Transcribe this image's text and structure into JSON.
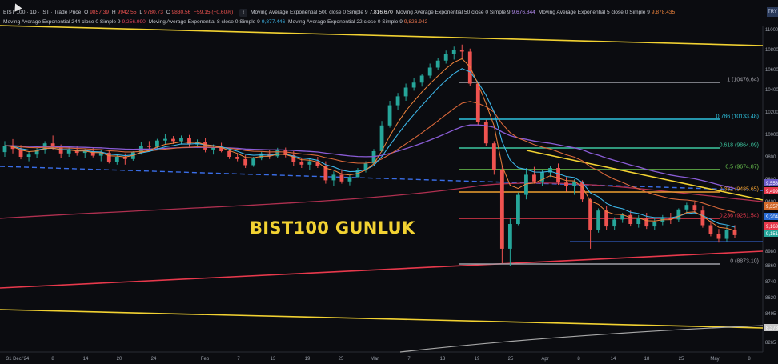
{
  "symbol_info": {
    "symbol": "BIST 100 · 1D · IST · Trade Price",
    "open_label": "O",
    "open": "9857.39",
    "high_label": "H",
    "high": "9942.55",
    "low_label": "L",
    "low": "9780.73",
    "close_label": "C",
    "close": "9830.56",
    "change": "−59.15 (−0.60%)"
  },
  "indicators_row1": [
    {
      "label": "Moving Average Exponential 500 close 0 Simple 9",
      "value": "7,816.670",
      "color": "#ffffff"
    },
    {
      "label": "Moving Average Exponential 50 close 0 Simple 9",
      "value": "9,676.844",
      "color": "#b48cf0"
    },
    {
      "label": "Moving Average Exponential 5 close 0 Simple 9",
      "value": "9,878.435",
      "color": "#f0843c"
    }
  ],
  "indicators_row2": [
    {
      "label": "Moving Average Exponential 244 close 0 Simple 9",
      "value": "9,256.990",
      "color": "#e0445c"
    },
    {
      "label": "Moving Average Exponential 8 close 0 Simple 9",
      "value": "9,877.446",
      "color": "#3cb4e6"
    },
    {
      "label": "Moving Average Exponential 22 close 0 Simple 9",
      "value": "9,826.942",
      "color": "#f07850"
    }
  ],
  "chart_label": "BIST100 GUNLUK",
  "currency_button": "TRY",
  "colors": {
    "background": "#0b0c10",
    "up": "#26a69a",
    "down": "#ef5350",
    "trendline": "#f2d232",
    "accent_red": "#e8394c"
  },
  "chart_data": {
    "type": "candlestick",
    "x_ticks": [
      "31 Dec '24",
      "8",
      "14",
      "20",
      "24",
      "Feb",
      "7",
      "13",
      "19",
      "25",
      "Mar",
      "7",
      "13",
      "19",
      "25",
      "Apr",
      "8",
      "14",
      "18",
      "25",
      "May",
      "8"
    ],
    "y_ticks": [
      11000,
      10800,
      10600,
      10400,
      10200,
      10000,
      9800,
      9600,
      9400,
      9200,
      8980,
      8860,
      8740,
      8620,
      8495,
      8378,
      8265
    ],
    "fibonacci": [
      {
        "level": "1 (10476.64)",
        "color": "#a0a0a8"
      },
      {
        "level": "0.786 (10133.48)",
        "color": "#2ec4e0"
      },
      {
        "level": "0.618 (9864.09)",
        "color": "#3cc8a0"
      },
      {
        "level": "0.5 (9674.87)",
        "color": "#6cc850"
      },
      {
        "level": "0.382 (9485.65)",
        "color": "#f0a030"
      },
      {
        "level": "0.236 (9251.54)",
        "color": "#e8394c"
      },
      {
        "level": "0 (8873.10)",
        "color": "#a0a0a8"
      }
    ],
    "price_tags": [
      {
        "value": "9,558",
        "color": "#6c5cc8"
      },
      {
        "value": "9,499",
        "color": "#e8394c"
      },
      {
        "value": "9,357",
        "color": "#d46a2a"
      },
      {
        "value": "9,204",
        "color": "#2a6cd4"
      },
      {
        "value": "9,163",
        "color": "#e8394c"
      },
      {
        "value": "9,151",
        "color": "#26a69a"
      },
      {
        "value": "8,378",
        "color": "#c8c8c8"
      }
    ],
    "candles": [
      [
        9842,
        9940,
        9800,
        9900
      ],
      [
        9900,
        9958,
        9830,
        9870
      ],
      [
        9870,
        9905,
        9778,
        9800
      ],
      [
        9800,
        9850,
        9760,
        9820
      ],
      [
        9820,
        9880,
        9790,
        9860
      ],
      [
        9860,
        9940,
        9830,
        9920
      ],
      [
        9920,
        9990,
        9860,
        9885
      ],
      [
        9885,
        9910,
        9790,
        9830
      ],
      [
        9830,
        9888,
        9800,
        9860
      ],
      [
        9860,
        9900,
        9810,
        9835
      ],
      [
        9835,
        9870,
        9790,
        9850
      ],
      [
        9850,
        9880,
        9795,
        9810
      ],
      [
        9810,
        9860,
        9760,
        9835
      ],
      [
        9835,
        9860,
        9740,
        9755
      ],
      [
        9755,
        9820,
        9730,
        9800
      ],
      [
        9800,
        9830,
        9730,
        9780
      ],
      [
        9780,
        9850,
        9765,
        9840
      ],
      [
        9840,
        9930,
        9820,
        9900
      ],
      [
        9900,
        9940,
        9860,
        9888
      ],
      [
        9888,
        9960,
        9870,
        9945
      ],
      [
        9945,
        10000,
        9910,
        9960
      ],
      [
        9960,
        9985,
        9915,
        9940
      ],
      [
        9940,
        9990,
        9910,
        9965
      ],
      [
        9965,
        9995,
        9890,
        9910
      ],
      [
        9910,
        9955,
        9880,
        9935
      ],
      [
        9935,
        9965,
        9840,
        9865
      ],
      [
        9865,
        9910,
        9820,
        9880
      ],
      [
        9880,
        9925,
        9840,
        9850
      ],
      [
        9850,
        9875,
        9780,
        9800
      ],
      [
        9800,
        9830,
        9760,
        9780
      ],
      [
        9780,
        9815,
        9700,
        9725
      ],
      [
        9725,
        9800,
        9710,
        9785
      ],
      [
        9785,
        9850,
        9770,
        9830
      ],
      [
        9830,
        9860,
        9780,
        9805
      ],
      [
        9805,
        9880,
        9790,
        9860
      ],
      [
        9860,
        9882,
        9795,
        9815
      ],
      [
        9815,
        9850,
        9720,
        9750
      ],
      [
        9750,
        9790,
        9700,
        9730
      ],
      [
        9730,
        9780,
        9680,
        9760
      ],
      [
        9760,
        9800,
        9700,
        9720
      ],
      [
        9720,
        9760,
        9560,
        9590
      ],
      [
        9590,
        9670,
        9540,
        9640
      ],
      [
        9640,
        9690,
        9560,
        9580
      ],
      [
        9580,
        9640,
        9545,
        9620
      ],
      [
        9620,
        9700,
        9610,
        9680
      ],
      [
        9680,
        9760,
        9660,
        9740
      ],
      [
        9740,
        9870,
        9730,
        9850
      ],
      [
        9850,
        10120,
        9840,
        10080
      ],
      [
        10080,
        10300,
        10060,
        10260
      ],
      [
        10260,
        10370,
        10220,
        10340
      ],
      [
        10340,
        10460,
        10300,
        10420
      ],
      [
        10420,
        10520,
        10390,
        10470
      ],
      [
        10470,
        10560,
        10430,
        10540
      ],
      [
        10540,
        10660,
        10510,
        10620
      ],
      [
        10620,
        10720,
        10600,
        10690
      ],
      [
        10690,
        10790,
        10660,
        10760
      ],
      [
        10760,
        10830,
        10700,
        10800
      ],
      [
        10800,
        10850,
        10720,
        10780
      ],
      [
        10780,
        10810,
        10440,
        10460
      ],
      [
        10460,
        10480,
        10080,
        10110
      ],
      [
        10110,
        10130,
        9900,
        9920
      ],
      [
        9920,
        9940,
        9640,
        9680
      ],
      [
        9680,
        9720,
        8880,
        9000
      ],
      [
        9000,
        9250,
        8860,
        9200
      ],
      [
        9200,
        9480,
        9190,
        9460
      ],
      [
        9460,
        9700,
        9420,
        9640
      ],
      [
        9640,
        9710,
        9560,
        9580
      ],
      [
        9580,
        9680,
        9540,
        9660
      ],
      [
        9660,
        9720,
        9620,
        9700
      ],
      [
        9700,
        9740,
        9550,
        9570
      ],
      [
        9570,
        9620,
        9490,
        9540
      ],
      [
        9540,
        9600,
        9460,
        9580
      ],
      [
        9580,
        9590,
        9400,
        9420
      ],
      [
        9420,
        9430,
        9000,
        9150
      ],
      [
        9150,
        9340,
        9130,
        9320
      ],
      [
        9320,
        9360,
        9150,
        9180
      ],
      [
        9180,
        9260,
        9150,
        9240
      ],
      [
        9240,
        9300,
        9210,
        9280
      ],
      [
        9280,
        9320,
        9180,
        9200
      ],
      [
        9200,
        9280,
        9170,
        9250
      ],
      [
        9250,
        9300,
        9160,
        9180
      ],
      [
        9180,
        9250,
        9150,
        9220
      ],
      [
        9220,
        9280,
        9190,
        9260
      ],
      [
        9260,
        9300,
        9200,
        9240
      ],
      [
        9240,
        9340,
        9220,
        9330
      ],
      [
        9330,
        9390,
        9290,
        9370
      ],
      [
        9370,
        9400,
        9300,
        9320
      ],
      [
        9320,
        9360,
        9170,
        9190
      ],
      [
        9190,
        9230,
        9100,
        9120
      ],
      [
        9120,
        9160,
        9050,
        9080
      ],
      [
        9080,
        9180,
        9060,
        9150
      ],
      [
        9150,
        9190,
        9090,
        9110
      ]
    ]
  }
}
